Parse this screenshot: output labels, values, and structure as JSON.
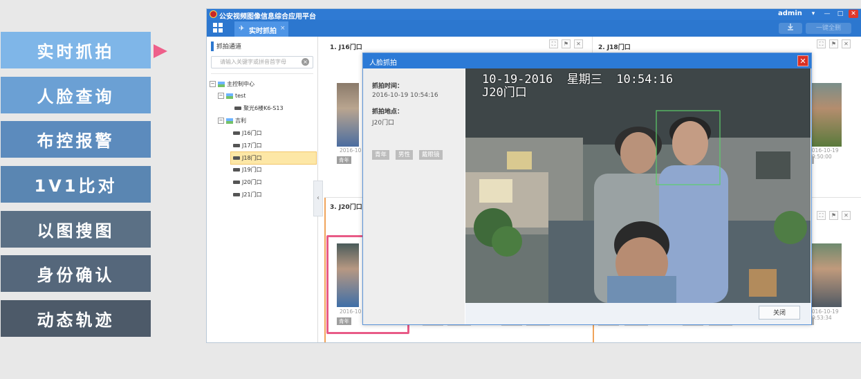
{
  "left_nav": {
    "items": [
      {
        "label": "实时抓拍",
        "color": "#7fb6e8"
      },
      {
        "label": "人脸查询",
        "color": "#6ba0d4"
      },
      {
        "label": "布控报警",
        "color": "#5c8bbd"
      },
      {
        "label": "1V1比对",
        "color": "#5a86b2"
      },
      {
        "label": "以图搜图",
        "color": "#5b7085"
      },
      {
        "label": "身份确认",
        "color": "#55677b"
      },
      {
        "label": "动态轨迹",
        "color": "#4d5a69"
      }
    ],
    "active_index": 0
  },
  "window": {
    "title": "公安视频图像信息综合应用平台",
    "user": "admin",
    "controls": {
      "dropdown": "▾",
      "minimize": "—",
      "maximize": "□",
      "close": "✕"
    }
  },
  "tabbar": {
    "active_tab": "实时抓拍",
    "tab_close": "×",
    "delete_all_label": "一键全删",
    "download_icon": "download-icon"
  },
  "channel_panel": {
    "title": "抓拍通道",
    "search_placeholder": "请输入关键字或拼音首字母",
    "tree": [
      {
        "label": "主控制中心",
        "toggle": "−",
        "type": "group"
      },
      {
        "label": "test",
        "toggle": "−",
        "type": "group"
      },
      {
        "label": "聚光6楼K6-S13",
        "type": "camera"
      },
      {
        "label": "吉利",
        "toggle": "−",
        "type": "group"
      },
      {
        "label": "J16门口",
        "type": "camera"
      },
      {
        "label": "J17门口",
        "type": "camera"
      },
      {
        "label": "J18门口",
        "type": "camera",
        "selected": true
      },
      {
        "label": "J19门口",
        "type": "camera"
      },
      {
        "label": "J20门口",
        "type": "camera"
      },
      {
        "label": "J21门口",
        "type": "camera"
      }
    ]
  },
  "grid": {
    "cells": [
      {
        "title": "1. J16门口"
      },
      {
        "title": "2. J18门口"
      },
      {
        "title": "3. J20门口"
      }
    ],
    "visible_thumbs": [
      {
        "timestamp": "2016-10",
        "tag": "青年"
      },
      {
        "timestamp": "2016-10-19 10:50:00",
        "tag": "性"
      },
      {
        "timestamp": "2016-10",
        "tag": "青年"
      },
      {
        "timestamp": "2016-10-19 10:53:34",
        "tag": "性"
      }
    ]
  },
  "dialog": {
    "title": "人脸抓拍",
    "close_glyph": "✕",
    "time_label": "抓拍时间：",
    "time_value": "2016-10-19 10:54:16",
    "place_label": "抓拍地点：",
    "place_value": "J20门口",
    "tags": [
      "青年",
      "男性",
      "戴眼镜"
    ],
    "overlay_datetime": "10-19-2016  星期三  10:54:16",
    "overlay_location": "J20门口",
    "close_button": "关闭"
  }
}
